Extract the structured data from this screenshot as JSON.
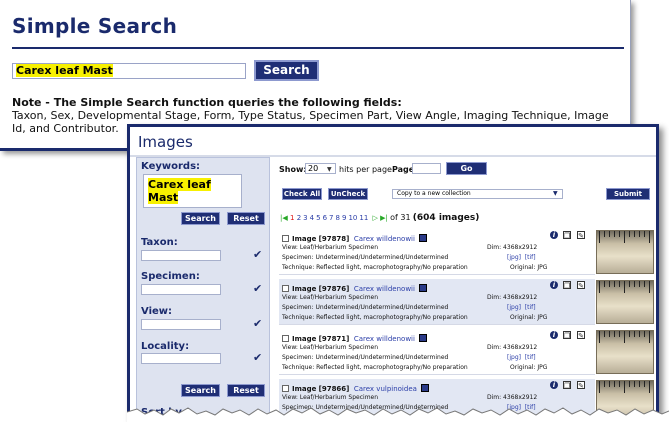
{
  "simple_search": {
    "title": "Simple Search",
    "query": "Carex leaf Mast",
    "button": "Search",
    "note_bold": "Note - The Simple Search function queries the following fields:",
    "note_text": "Taxon, Sex, Developmental Stage, Form, Type Status, Specimen Part, View Angle, Imaging Technique, Image Id, and Contributor."
  },
  "images_window": {
    "title": "Images",
    "sidebar": {
      "keywords_label": "Keywords:",
      "keywords_value": "Carex leaf Mast",
      "search_label": "Search",
      "reset_label": "Reset",
      "taxon_label": "Taxon:",
      "specimen_label": "Specimen:",
      "view_label": "View:",
      "locality_label": "Locality:",
      "search2_label": "Search",
      "reset2_label": "Reset",
      "sort_label": "Sort by"
    },
    "toolbar": {
      "show_label": "Show:",
      "show_value": "20",
      "hits_label": "hits per page",
      "page_label": "Page:",
      "go_label": "Go",
      "check_all": "Check All",
      "uncheck": "UnCheck",
      "collection_select": "Copy to a new collection",
      "submit": "Submit"
    },
    "pager": {
      "current": "1",
      "pages": [
        "2",
        "3",
        "4",
        "5",
        "6",
        "7",
        "8",
        "9",
        "10",
        "11"
      ],
      "of_text": "of 31",
      "count_text": "(604 images)"
    },
    "results": [
      {
        "label": "Image",
        "id": "[97878]",
        "species": "Carex willdenowii",
        "view": "View: Leaf/Herbarium Specimen",
        "dim": "Dim: 4368x2912",
        "specimen": "Specimen: Undetermined/Undetermined/Undetermined",
        "jpg": "[jpg]",
        "tif": "[tif]",
        "technique": "Technique: Reflected light, macrophotography/No preparation",
        "original": "Original: JPG"
      },
      {
        "label": "Image",
        "id": "[97876]",
        "species": "Carex willdenowii",
        "view": "View: Leaf/Herbarium Specimen",
        "dim": "Dim: 4368x2912",
        "specimen": "Specimen: Undetermined/Undetermined/Undetermined",
        "jpg": "[jpg]",
        "tif": "[tif]",
        "technique": "Technique: Reflected light, macrophotography/No preparation",
        "original": "Original: JPG"
      },
      {
        "label": "Image",
        "id": "[97871]",
        "species": "Carex willdenowii",
        "view": "View: Leaf/Herbarium Specimen",
        "dim": "Dim: 4368x2912",
        "specimen": "Specimen: Undetermined/Undetermined/Undetermined",
        "jpg": "[jpg]",
        "tif": "[tif]",
        "technique": "Technique: Reflected light, macrophotography/No preparation",
        "original": "Original: JPG"
      },
      {
        "label": "Image",
        "id": "[97866]",
        "species": "Carex vulpinoidea",
        "view": "View: Leaf/Herbarium Specimen",
        "dim": "Dim: 4368x2912",
        "specimen": "Specimen: Undetermined/Undetermined/Undetermined",
        "jpg": "[jpg]",
        "tif": "[tif]",
        "technique": "",
        "original": ""
      }
    ],
    "thumb_numbers": [
      "1",
      "2",
      "3",
      "2",
      "3",
      "1",
      "2",
      "1",
      "2"
    ]
  },
  "colors": {
    "navy": "#1a2a6c",
    "highlight": "#f7f000",
    "link": "#2b3ea8",
    "sidebar_bg": "#dee3f0"
  }
}
